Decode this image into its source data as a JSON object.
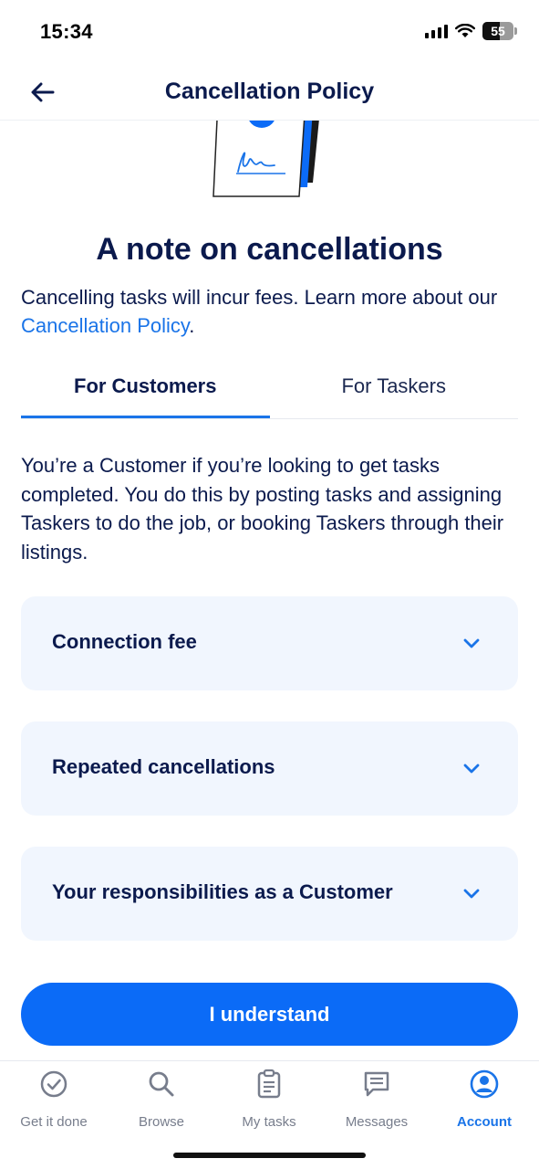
{
  "status_bar": {
    "time": "15:34",
    "battery": "55"
  },
  "header": {
    "title": "Cancellation Policy",
    "back_icon": "arrow-left-icon"
  },
  "illustration": {
    "icon": "signed-document-illustration"
  },
  "headline": "A note on cancellations",
  "intro": {
    "text_before": "Cancelling tasks will incur fees. Learn more about our ",
    "link": "Cancellation Policy",
    "text_after": "."
  },
  "tabs": [
    {
      "label": "For Customers",
      "active": true
    },
    {
      "label": "For Taskers",
      "active": false
    }
  ],
  "description": "You’re a Customer if you’re looking to get tasks completed. You do this by posting tasks and assigning Taskers to do the job, or booking Taskers through their listings.",
  "accordions": [
    {
      "title": "Connection fee",
      "icon": "chevron-down-icon"
    },
    {
      "title": "Repeated cancellations",
      "icon": "chevron-down-icon"
    },
    {
      "title": "Your responsibilities as a Customer",
      "icon": "chevron-down-icon"
    }
  ],
  "primary_button": {
    "label": "I understand"
  },
  "bottom_nav": [
    {
      "label": "Get it done",
      "icon": "check-circle-icon",
      "active": false
    },
    {
      "label": "Browse",
      "icon": "search-icon",
      "active": false
    },
    {
      "label": "My tasks",
      "icon": "clipboard-icon",
      "active": false
    },
    {
      "label": "Messages",
      "icon": "chat-icon",
      "active": false
    },
    {
      "label": "Account",
      "icon": "account-icon",
      "active": true
    }
  ],
  "colors": {
    "accent": "#1a74e8",
    "button": "#0b6bf7",
    "text": "#0b1a4d",
    "card": "#f1f6fe",
    "nav_inactive": "#777d8c"
  }
}
